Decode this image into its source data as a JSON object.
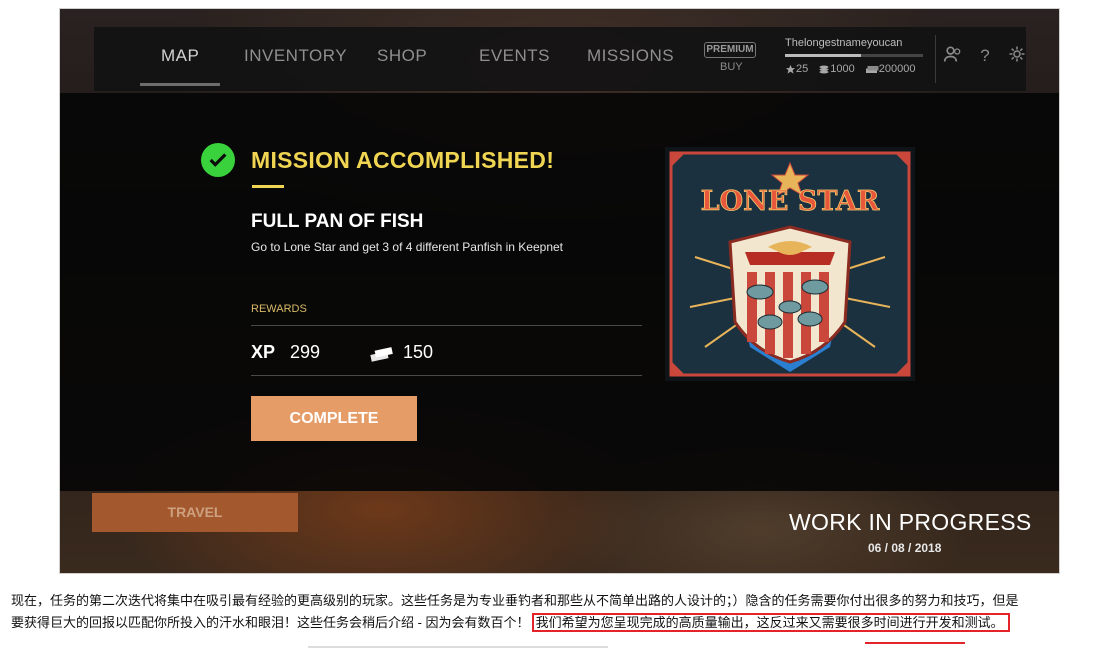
{
  "nav": {
    "tabs": [
      {
        "label": "MAP"
      },
      {
        "label": "INVENTORY"
      },
      {
        "label": "SHOP"
      },
      {
        "label": "EVENTS"
      },
      {
        "label": "MISSIONS"
      }
    ],
    "premium_badge": "PREMIUM",
    "buy_label": "BUY"
  },
  "player": {
    "username": "Thelongestnameyoucan",
    "level": "25",
    "silver": "1000",
    "gold": "200000",
    "xp_progress": 0.55
  },
  "mission": {
    "status_title": "MISSION ACCOMPLISHED!",
    "name": "FULL PAN OF FISH",
    "description": "Go to Lone Star and get 3 of 4 different Panfish in Keepnet",
    "rewards_label": "REWARDS",
    "xp_label": "XP",
    "xp_value": "299",
    "money_value": "150",
    "complete_label": "COMPLETE"
  },
  "badge": {
    "title": "LONE STAR",
    "icon": "lone-star-badge-icon"
  },
  "travel_label": "TRAVEL",
  "watermark": {
    "title": "WORK IN PROGRESS",
    "date": "06 / 08 / 2018"
  },
  "caption": {
    "line1": "现在，任务的第二次迭代将集中在吸引最有经验的更高级别的玩家。这些任务是为专业垂钓者和那些从不简单出路的人设计的；）隐含的任务需要你付出很多的努力和技巧，但是",
    "line2_start": "要获得巨大的回报以匹配你所投入的汗水和眼泪！这些任务会稍后介绍 - 因为会有数百个！",
    "line2_highlight": "我们希望为您呈现完成的高质量输出，这反过来又需要很多时间进行开发和测试。"
  },
  "colors": {
    "accent_yellow": "#f0d553",
    "complete_button": "#e69c66",
    "travel_button": "#a4582e",
    "success_green": "#39d23c",
    "highlight_red": "#e3242b"
  }
}
